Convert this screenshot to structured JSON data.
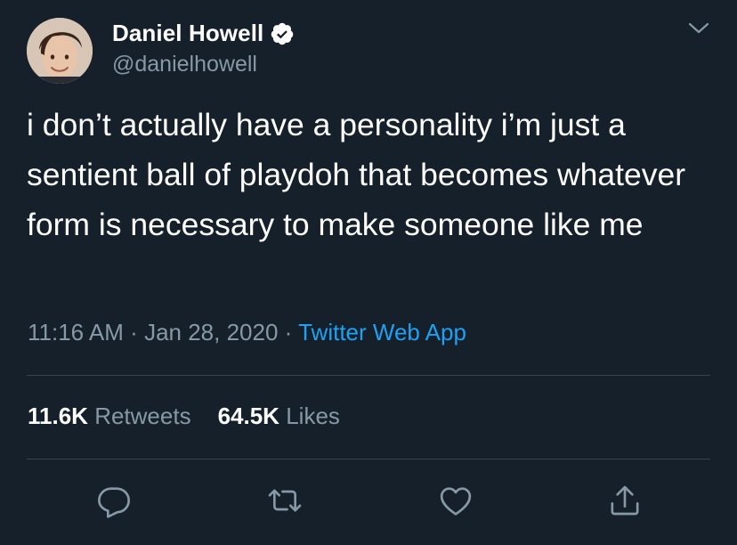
{
  "author": {
    "display_name": "Daniel Howell",
    "handle": "@danielhowell",
    "verified": true,
    "verified_icon": "verified-badge-icon",
    "avatar_icon": "avatar"
  },
  "tweet": {
    "text": "i don’t actually have a personality i’m just a sentient ball of playdoh that becomes whatever form is necessary to make someone like me",
    "time": "11:16 AM",
    "separator": "·",
    "date": "Jan 28, 2020",
    "source": "Twitter Web App"
  },
  "stats": {
    "retweets_count": "11.6K",
    "retweets_label": "Retweets",
    "likes_count": "64.5K",
    "likes_label": "Likes"
  },
  "actions": {
    "reply_icon": "reply-icon",
    "retweet_icon": "retweet-icon",
    "like_icon": "heart-icon",
    "share_icon": "share-icon"
  },
  "colors": {
    "background": "#15202b",
    "primary_text": "#ffffff",
    "secondary_text": "#8899a6",
    "accent": "#1da1f2",
    "divider": "#38444d"
  }
}
